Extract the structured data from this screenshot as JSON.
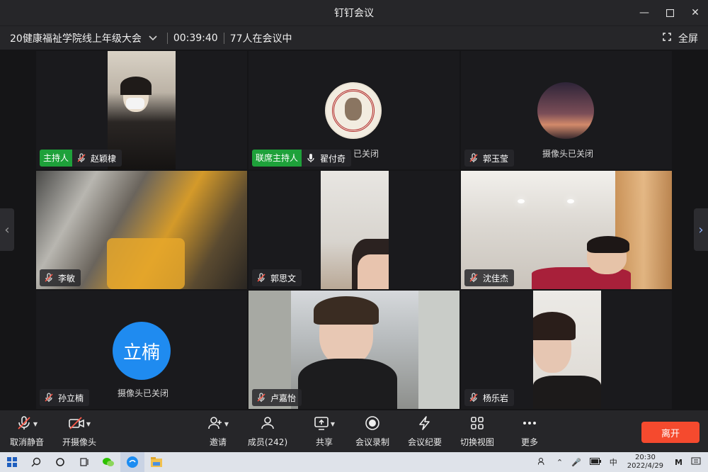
{
  "window": {
    "title": "钉钉会议"
  },
  "meeting": {
    "name": "20健康福祉学院线上年级大会",
    "elapsed": "00:39:40",
    "count_text": "77人在会议中",
    "fullscreen_label": "全屏"
  },
  "participants": [
    {
      "name": "赵颖棣",
      "badge": "主持人",
      "muted": true
    },
    {
      "name": "翟付奇",
      "badge": "联席主持人",
      "muted": false,
      "camoff_text": "已关闭"
    },
    {
      "name": "郭玉莹",
      "muted": true,
      "camoff_text": "摄像头已关闭"
    },
    {
      "name": "李敏",
      "muted": true
    },
    {
      "name": "郭思文",
      "muted": true
    },
    {
      "name": "沈佳杰",
      "muted": true
    },
    {
      "name": "孙立楠",
      "muted": true,
      "avatar_text": "立楠",
      "camoff_text": "摄像头已关闭"
    },
    {
      "name": "卢嘉怡",
      "muted": true
    },
    {
      "name": "杨乐岩",
      "muted": true
    }
  ],
  "toolbar": {
    "unmute": "取消静音",
    "camera": "开摄像头",
    "invite": "邀请",
    "members": "成员(242)",
    "share": "共享",
    "record": "会议录制",
    "minutes": "会议纪要",
    "view": "切换视图",
    "more": "更多",
    "leave": "离开"
  },
  "taskbar": {
    "ime": "中",
    "time": "20:30",
    "date": "2022/4/29"
  },
  "colors": {
    "accent_green": "#1ea13a",
    "leave_red": "#f54a2e",
    "avatar_blue": "#1f8bf0"
  }
}
